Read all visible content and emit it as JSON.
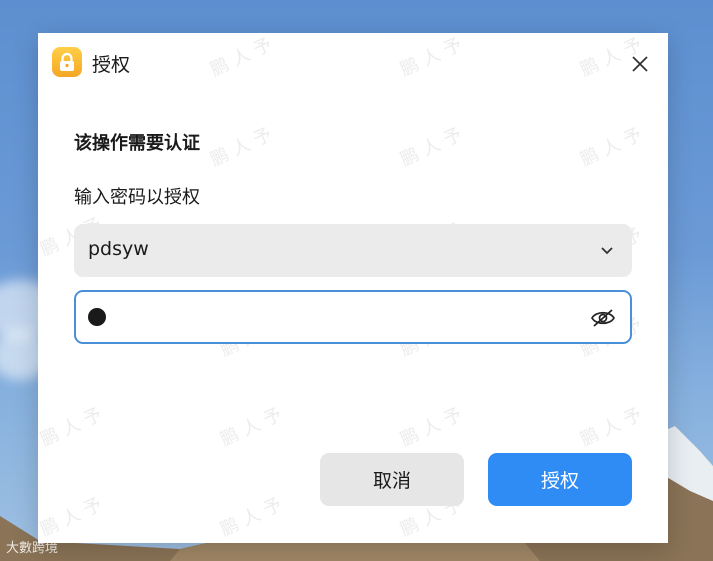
{
  "dialog": {
    "title": "授权",
    "heading": "该操作需要认证",
    "prompt": "输入密码以授权",
    "user": "pdsyw",
    "password_masked": "●",
    "cancel_label": "取消",
    "authorize_label": "授权",
    "icons": {
      "app": "lock-icon",
      "close": "close-icon",
      "dropdown": "chevron-down-icon",
      "visibility": "eye-off-icon"
    }
  },
  "watermark": {
    "text": "鹏 人 予"
  },
  "corner": {
    "text": "大數跨境"
  },
  "colors": {
    "accent": "#2f8cf4",
    "focus_border": "#4a90d9",
    "button_secondary": "#e6e6e6",
    "field_bg": "#ebebeb"
  }
}
